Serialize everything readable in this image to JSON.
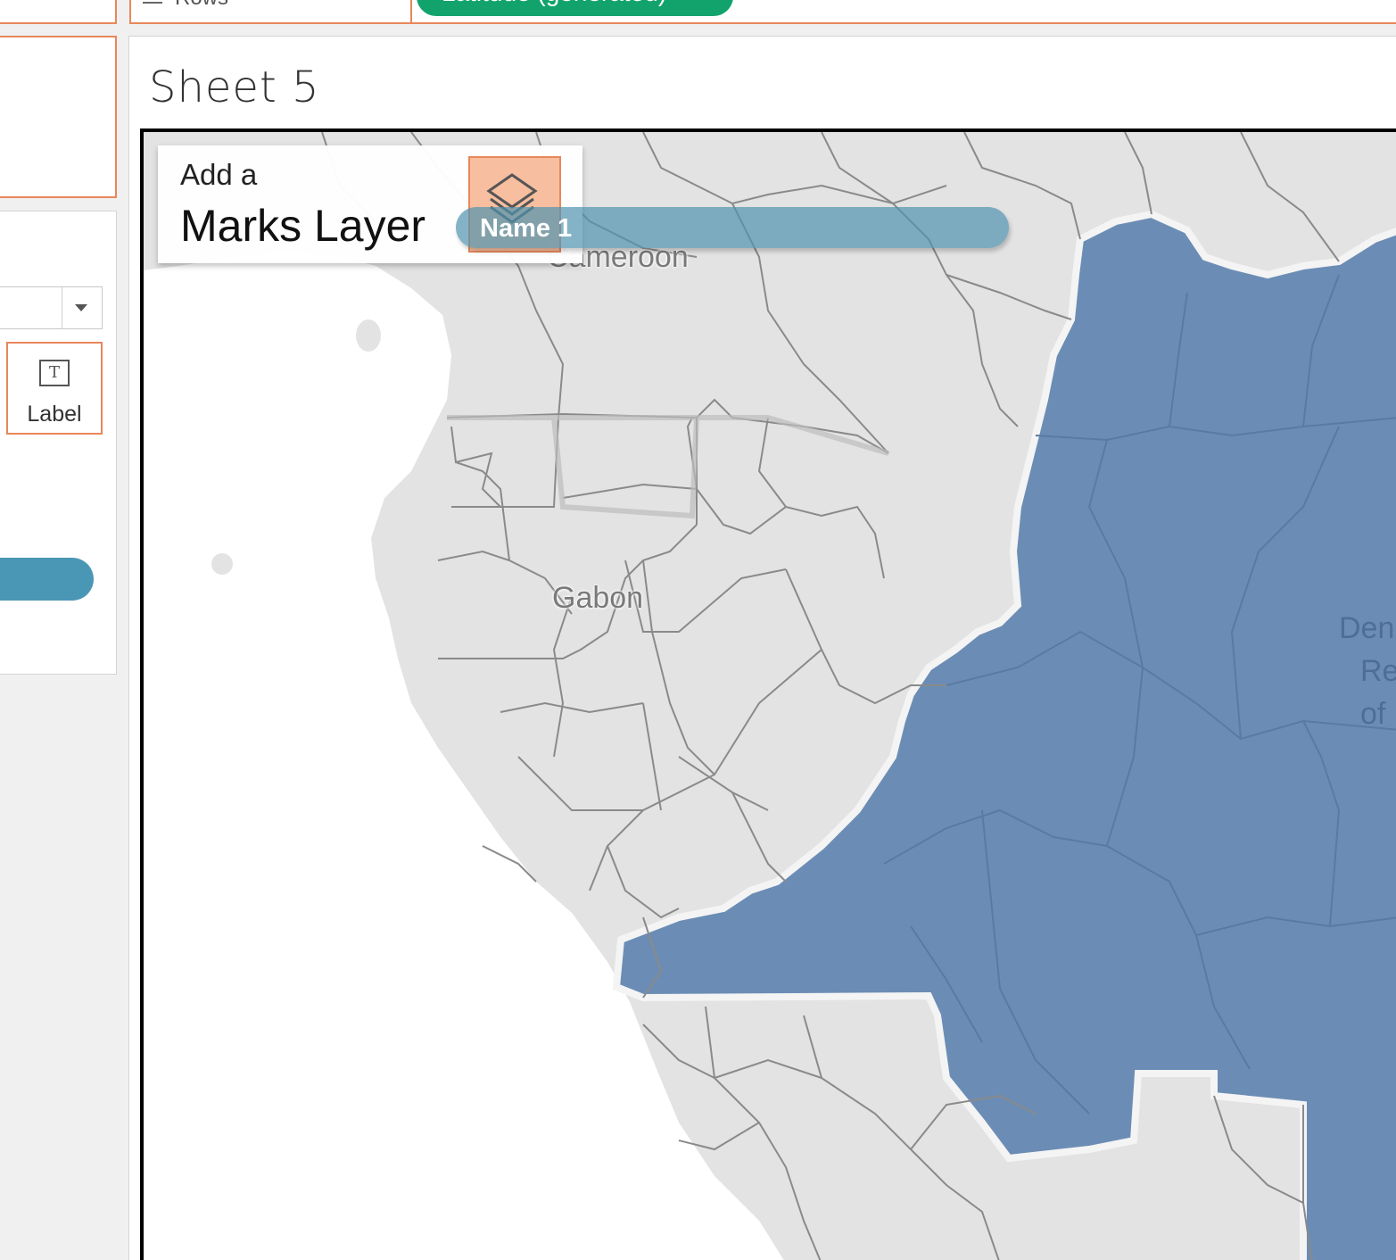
{
  "shelf": {
    "rows_label": "Rows",
    "rows_pill": "Latitude (generated)"
  },
  "marks": {
    "label_button": "Label",
    "label_icon": "T"
  },
  "sheet": {
    "title": "Sheet 5"
  },
  "overlay": {
    "add_a": "Add a",
    "marks_layer": "Marks Layer",
    "dragged_pill": "Name 1"
  },
  "map": {
    "labels": {
      "cameroon": "Cameroon",
      "gabon": "Gabon",
      "drc_line1": "Den",
      "drc_line2": "Re",
      "drc_line3": "of"
    },
    "colors": {
      "land": "#e3e3e3",
      "water": "#ffffff",
      "highlight": "#6b8db5",
      "border": "#8a8a8a"
    }
  }
}
